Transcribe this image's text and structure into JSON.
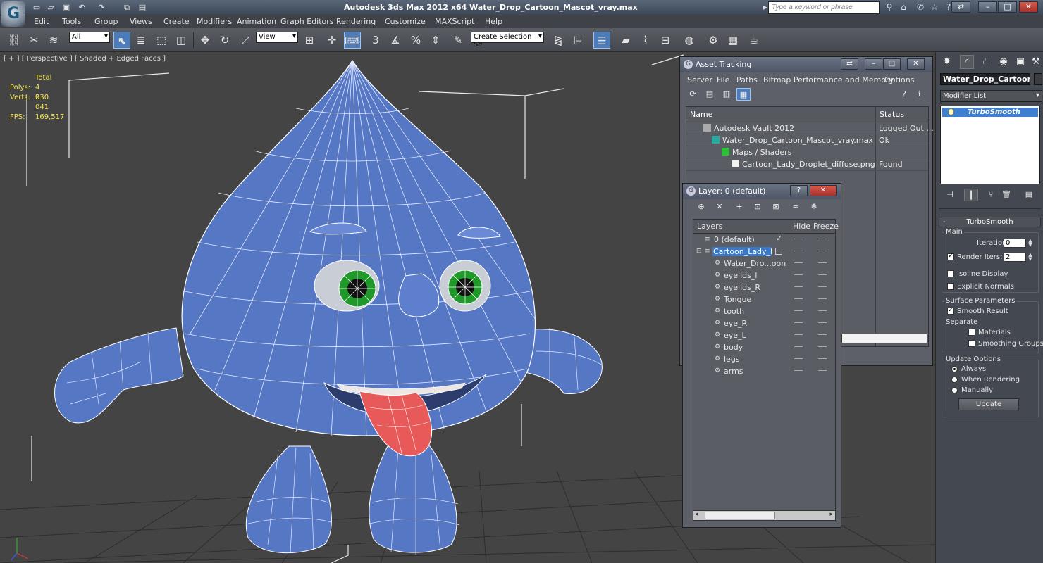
{
  "title_bar": {
    "title": "Autodesk 3ds Max  2012 x64     Water_Drop_Cartoon_Mascot_vray.max",
    "search_placeholder": "Type a keyword or phrase"
  },
  "menu": {
    "items": [
      "Edit",
      "Tools",
      "Group",
      "Views",
      "Create",
      "Modifiers",
      "Animation",
      "Graph Editors",
      "Rendering",
      "Customize",
      "MAXScript",
      "Help"
    ]
  },
  "toolbar": {
    "selection_filter": "All",
    "ref_coord": "View",
    "snap_3": "3",
    "snap_percent": "%",
    "named_selection": "Create Selection Se"
  },
  "viewport": {
    "label": "[ + ] [ Perspective ] [ Shaded + Edged Faces ]",
    "stats_header": "Total",
    "polys_label": "Polys:",
    "polys_value": "4 030",
    "verts_label": "Verts:",
    "verts_value": "2 041",
    "fps_label": "FPS:",
    "fps_value": "169,517"
  },
  "asset_tracking": {
    "title": "Asset Tracking",
    "menu": [
      "Server",
      "File",
      "Paths",
      "Bitmap Performance and Memory",
      "Options"
    ],
    "col_name": "Name",
    "col_status": "Status",
    "rows": [
      {
        "name": "Autodesk Vault 2012",
        "status": "Logged Out ..."
      },
      {
        "name": "Water_Drop_Cartoon_Mascot_vray.max",
        "status": "Ok"
      },
      {
        "name": "Maps / Shaders",
        "status": ""
      },
      {
        "name": "Cartoon_Lady_Droplet_diffuse.png",
        "status": "Found"
      }
    ]
  },
  "layer_dialog": {
    "title": "Layer: 0 (default)",
    "col_layers": "Layers",
    "col_hide": "Hide",
    "col_freeze": "Freeze",
    "rows": [
      {
        "name": "0 (default)"
      },
      {
        "name": "Cartoon_Lady_Drop"
      },
      {
        "name": "Water_Dro...oon"
      },
      {
        "name": "eyelids_l"
      },
      {
        "name": "eyelids_R"
      },
      {
        "name": "Tongue"
      },
      {
        "name": "tooth"
      },
      {
        "name": "eye_R"
      },
      {
        "name": "eye_L"
      },
      {
        "name": "body"
      },
      {
        "name": "legs"
      },
      {
        "name": "arms"
      }
    ]
  },
  "command_panel": {
    "object_name": "Water_Drop_Cartoon_Ma",
    "modifier_list": "Modifier List",
    "stack_item": "TurboSmooth",
    "rollout_title": "TurboSmooth",
    "main_group": "Main",
    "iterations_label": "Iterations:",
    "iterations_value": "0",
    "render_iters_label": "Render Iters:",
    "render_iters_value": "2",
    "isoline_label": "Isoline Display",
    "explicit_normals_label": "Explicit Normals",
    "surface_group": "Surface Parameters",
    "smooth_result_label": "Smooth Result",
    "separate_label": "Separate",
    "materials_label": "Materials",
    "smoothing_groups_label": "Smoothing Groups",
    "update_group": "Update Options",
    "always_label": "Always",
    "when_rendering_label": "When Rendering",
    "manually_label": "Manually",
    "update_button": "Update"
  },
  "colors": {
    "mesh_blue": "#5577c4",
    "wire": "#ffffff",
    "tongue": "#e85a5a",
    "eye_green": "#1f9a2a",
    "selection_blue": "#3a78c8",
    "stats_yellow": "#f5e44a"
  }
}
